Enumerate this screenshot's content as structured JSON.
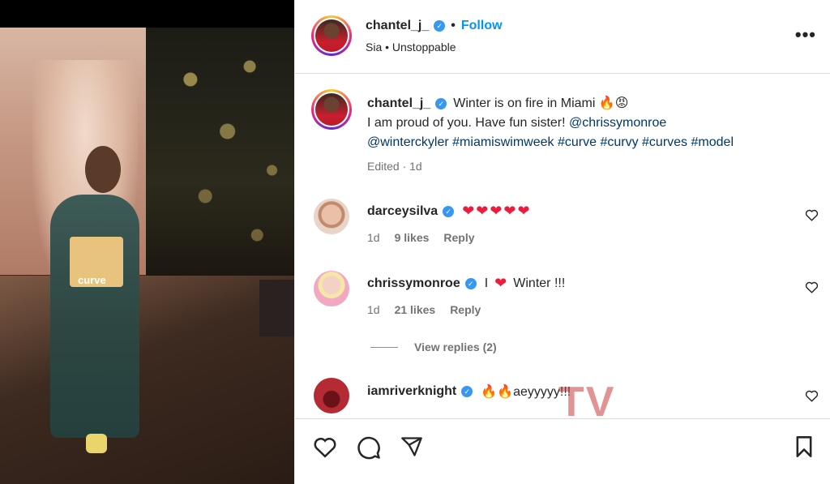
{
  "post": {
    "username": "chantel_j_",
    "follow_label": "Follow",
    "audio": "Sia • Unstoppable",
    "photo_bag_text": "curve"
  },
  "caption": {
    "username": "chantel_j_",
    "text_line1": "Winter is on fire in Miami",
    "emoji1": "🔥",
    "emoji2": "😡",
    "text_line2": "I am proud of you. Have fun sister! ",
    "mention1": "@chrissymonroe",
    "mention2": "@winterckyler",
    "hashtags": [
      "#miamiswimweek",
      "#curve",
      "#curvy",
      "#curves",
      "#model"
    ],
    "meta": "Edited · 1d"
  },
  "comments": [
    {
      "username": "darceysilva",
      "text": "❤❤❤❤❤",
      "time": "1d",
      "likes": "9 likes",
      "reply": "Reply",
      "avatar_color": "#e8c7b8"
    },
    {
      "username": "chrissymonroe",
      "text_pre": "I",
      "text_heart": "❤",
      "text_post": "Winter !!!",
      "time": "1d",
      "likes": "21 likes",
      "reply": "Reply",
      "avatar_color": "#f2b6c9"
    },
    {
      "username": "iamriverknight",
      "text": "🔥🔥aeyyyyy!!!",
      "avatar_color": "#b52b33"
    }
  ],
  "view_replies": "View replies (2)",
  "watermark": "TV",
  "icons": {
    "like": "heart-icon",
    "comment": "comment-icon",
    "share": "share-icon",
    "save": "bookmark-icon",
    "more": "more-options-icon"
  }
}
